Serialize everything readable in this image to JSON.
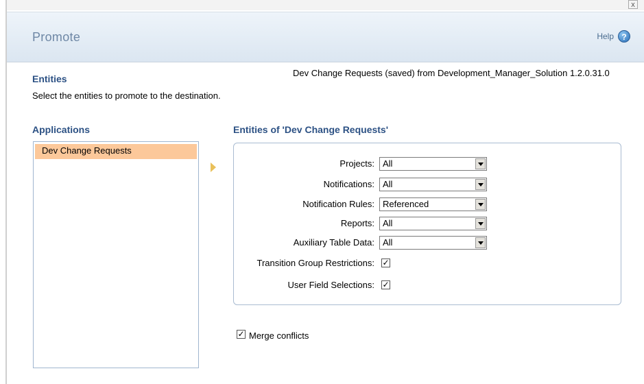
{
  "window": {
    "close_label": "x"
  },
  "header": {
    "title": "Promote",
    "help_label": "Help",
    "help_glyph": "?"
  },
  "entities_section": {
    "title": "Entities",
    "source": "Dev Change Requests (saved) from Development_Manager_Solution 1.2.0.31.0",
    "instructions": "Select the entities to promote to the destination."
  },
  "applications": {
    "title": "Applications",
    "items": [
      {
        "label": "Dev Change Requests",
        "selected": true
      }
    ]
  },
  "entities_panel": {
    "title": "Entities of 'Dev Change Requests'",
    "fields": [
      {
        "label": "Projects:",
        "value": "All"
      },
      {
        "label": "Notifications:",
        "value": "All"
      },
      {
        "label": "Notification Rules:",
        "value": "Referenced"
      },
      {
        "label": "Reports:",
        "value": "All"
      },
      {
        "label": "Auxiliary Table Data:",
        "value": "All"
      }
    ],
    "checkboxes": [
      {
        "label": "Transition Group Restrictions:",
        "checked": true
      },
      {
        "label": "User Field Selections:",
        "checked": true
      }
    ]
  },
  "merge_conflicts": {
    "label": "Merge conflicts",
    "checked": true
  },
  "colors": {
    "selected_row": "#fcc89a",
    "section_title": "#2c5184",
    "header_title": "#6e87a5"
  },
  "icons": {
    "help": "help-icon",
    "arrow": "arrow-right-icon",
    "close": "close-icon"
  }
}
